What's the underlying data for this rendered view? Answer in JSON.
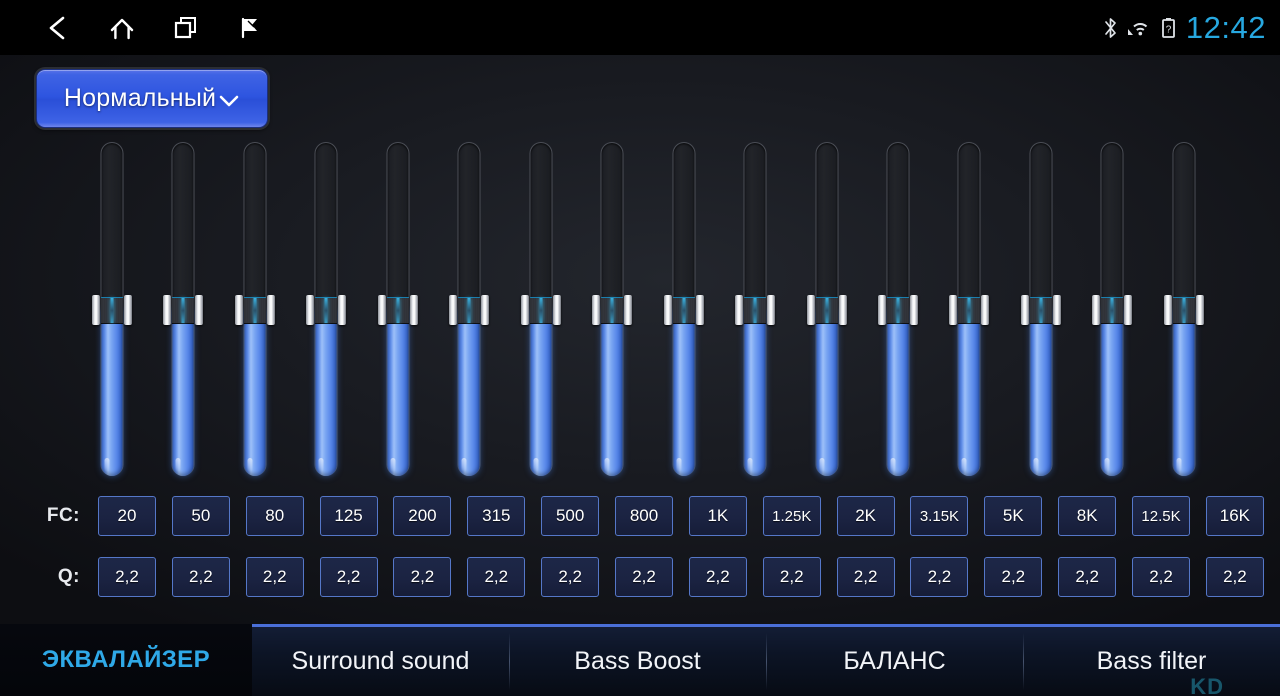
{
  "statusbar": {
    "nav": [
      {
        "name": "back-icon",
        "label": "Back"
      },
      {
        "name": "home-icon",
        "label": "Home"
      },
      {
        "name": "recents-icon",
        "label": "Recent apps"
      },
      {
        "name": "flag-icon",
        "label": "Flag"
      }
    ],
    "icons": [
      {
        "name": "bluetooth-icon",
        "label": "Bluetooth"
      },
      {
        "name": "wifi-icon",
        "label": "Wi-Fi"
      },
      {
        "name": "battery-icon",
        "label": "Battery"
      }
    ],
    "clock": "12:42",
    "clock_color": "#27a8e0"
  },
  "preset": {
    "label": "Нормальный",
    "chevron": "chevron-down-icon",
    "accent": "#2e55e0"
  },
  "equalizer": {
    "band_count": 16,
    "fc_label": "FC:",
    "q_label": "Q:",
    "fc_values": [
      "20",
      "50",
      "80",
      "125",
      "200",
      "315",
      "500",
      "800",
      "1K",
      "1.25K",
      "2K",
      "3.15K",
      "5K",
      "8K",
      "12.5K",
      "16K"
    ],
    "q_values": [
      "2,2",
      "2,2",
      "2,2",
      "2,2",
      "2,2",
      "2,2",
      "2,2",
      "2,2",
      "2,2",
      "2,2",
      "2,2",
      "2,2",
      "2,2",
      "2,2",
      "2,2",
      "2,2"
    ],
    "slider_positions": [
      50,
      50,
      50,
      50,
      50,
      50,
      50,
      50,
      50,
      50,
      50,
      50,
      50,
      50,
      50,
      50
    ],
    "fill_color": "#7aa6f2",
    "track_color": "#1b1d23"
  },
  "tabs": {
    "active_index": 0,
    "items": [
      {
        "label": "ЭКВАЛАЙЗЕР",
        "active": true
      },
      {
        "label": "Surround sound",
        "active": false
      },
      {
        "label": "Bass Boost",
        "active": false
      },
      {
        "label": "БАЛАНС",
        "active": false
      },
      {
        "label": "Bass filter",
        "active": false
      }
    ],
    "active_color": "#2fa9e8",
    "indicator_color": "#4a6fd8"
  },
  "watermark": "KD"
}
